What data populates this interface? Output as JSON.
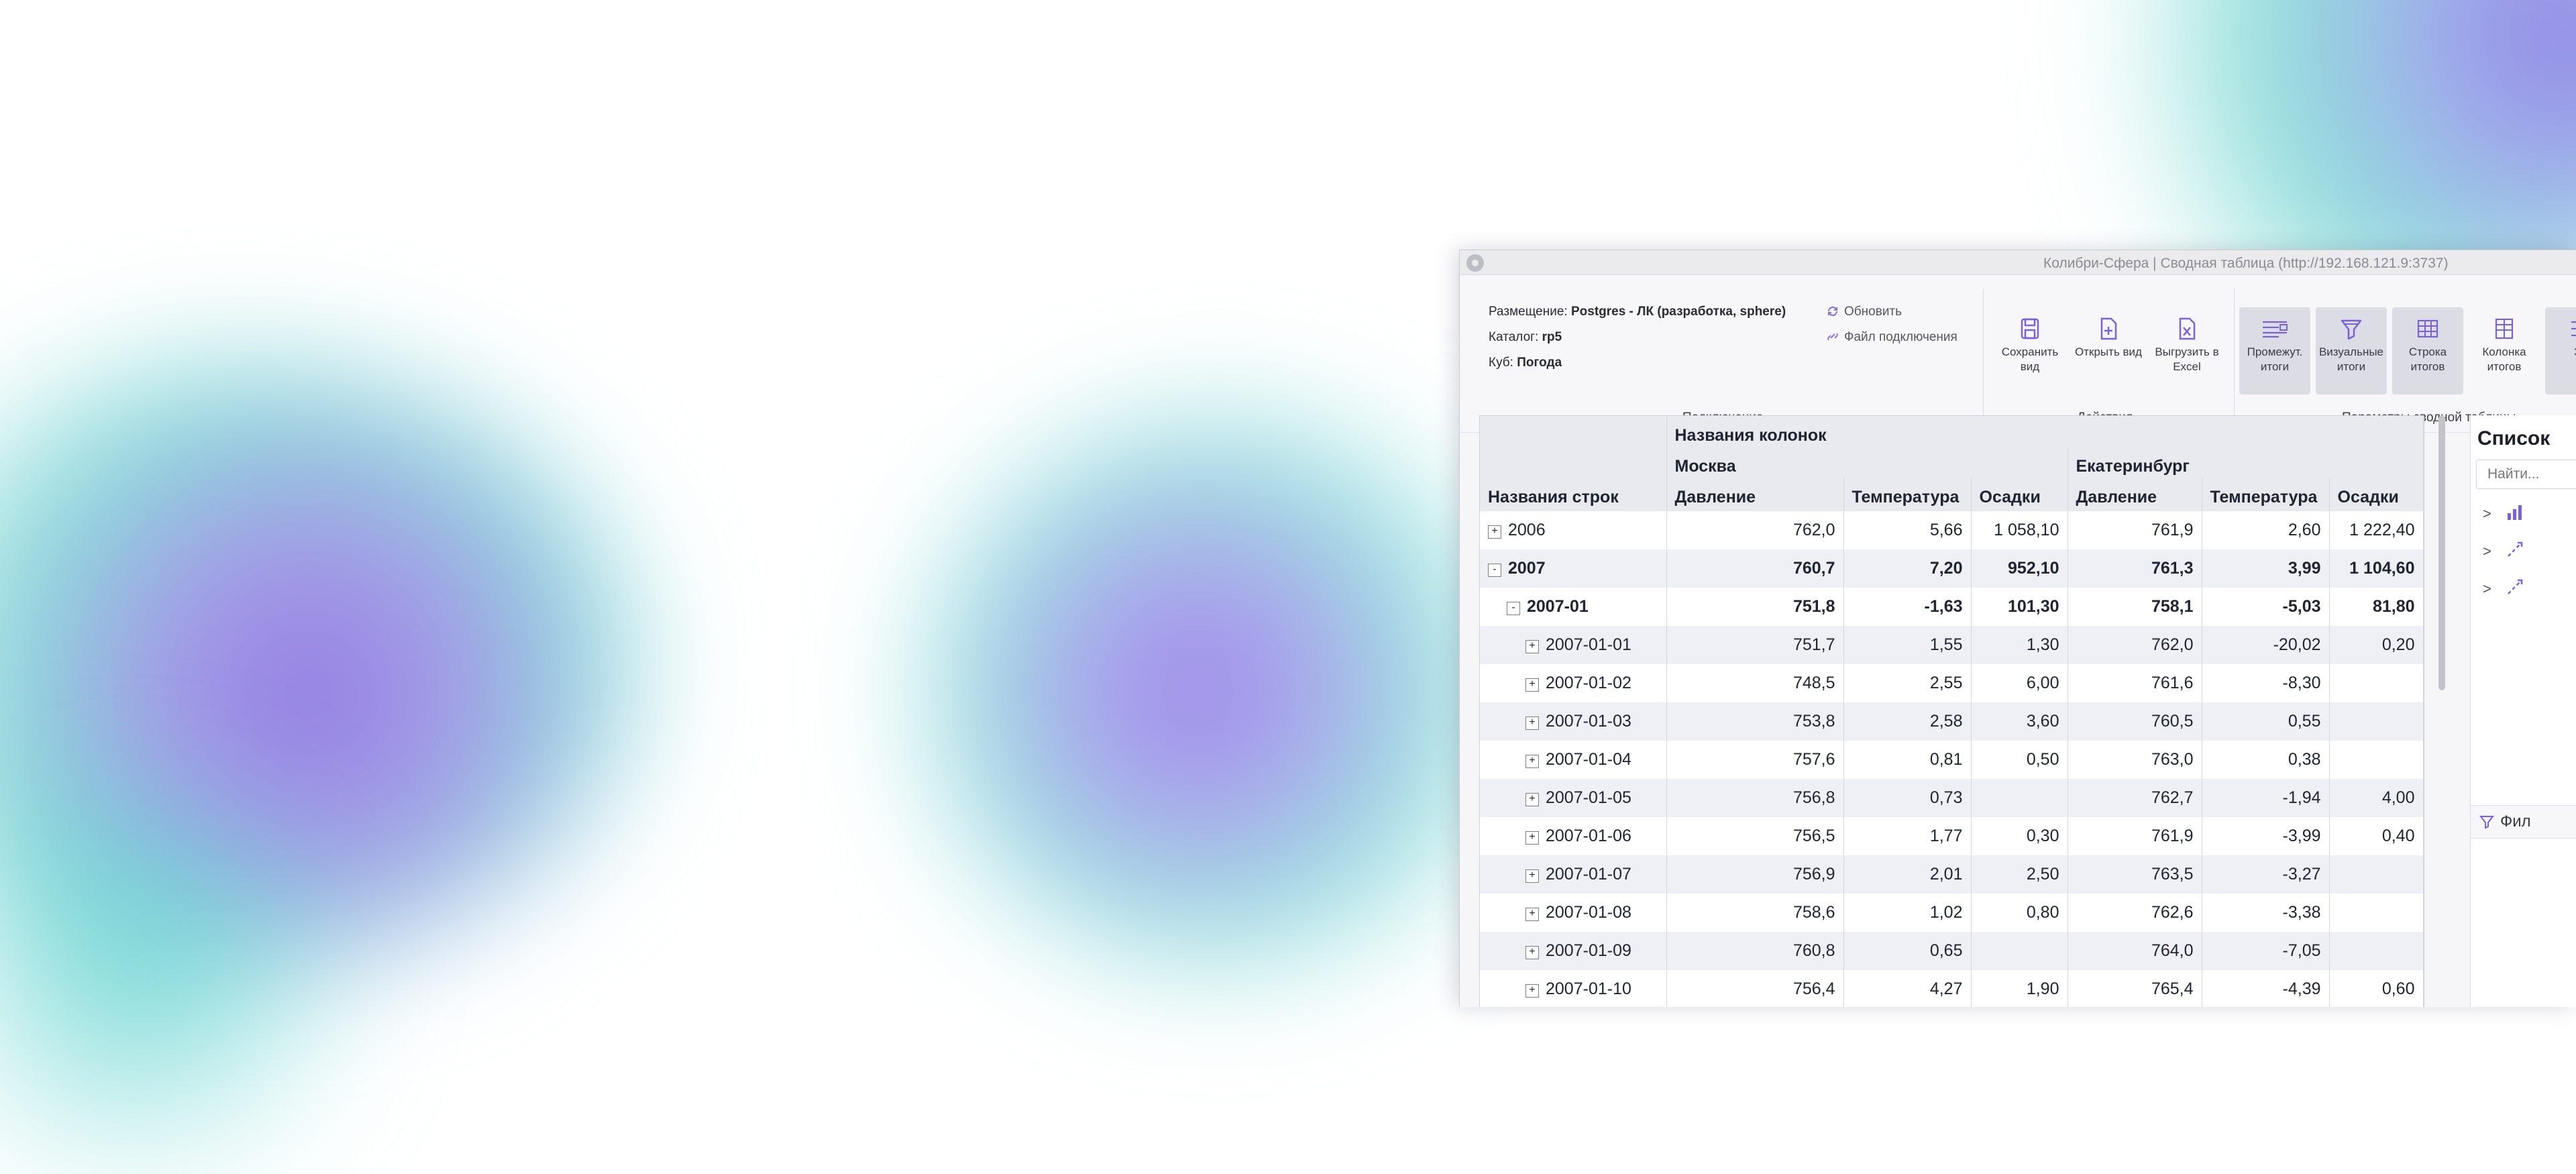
{
  "window": {
    "title": "Колибри-Сфера | Сводная таблица (http://192.168.121.9:3737)"
  },
  "connection": {
    "placement_label": "Размещение:",
    "placement_value": "Postgres - ЛК (разработка, sphere)",
    "catalog_label": "Каталог:",
    "catalog_value": "rp5",
    "cube_label": "Куб:",
    "cube_value": "Погода",
    "refresh_label": "Обновить",
    "conn_file_label": "Файл подключения",
    "group_label": "Подключение"
  },
  "actions": {
    "save_view": "Сохранить вид",
    "open_view": "Открыть вид",
    "export_excel": "Выгрузить в Excel",
    "group_label": "Действия"
  },
  "pivot_params": {
    "subtotals": "Промежут. итоги",
    "visual_totals": "Визуальные итоги",
    "row_totals": "Строка итогов",
    "col_totals": "Колонка итогов",
    "cut_label": "За",
    "group_label": "Параметры сводной таблицы"
  },
  "accent_color": "#7b61d8",
  "table": {
    "row_header": "Названия строк",
    "col_header": "Названия колонок",
    "cities": [
      "Москва",
      "Екатеринбург"
    ],
    "measures": [
      "Давление",
      "Температура",
      "Осадки"
    ],
    "rows": [
      {
        "label": "2006",
        "toggle": "+",
        "level": 0,
        "bold": false,
        "values": [
          "762,0",
          "5,66",
          "1 058,10",
          "761,9",
          "2,60",
          "1 222,40"
        ]
      },
      {
        "label": "2007",
        "toggle": "-",
        "level": 0,
        "bold": true,
        "values": [
          "760,7",
          "7,20",
          "952,10",
          "761,3",
          "3,99",
          "1 104,60"
        ]
      },
      {
        "label": "2007-01",
        "toggle": "-",
        "level": 1,
        "bold": true,
        "values": [
          "751,8",
          "-1,63",
          "101,30",
          "758,1",
          "-5,03",
          "81,80"
        ]
      },
      {
        "label": "2007-01-01",
        "toggle": "+",
        "level": 2,
        "bold": false,
        "values": [
          "751,7",
          "1,55",
          "1,30",
          "762,0",
          "-20,02",
          "0,20"
        ]
      },
      {
        "label": "2007-01-02",
        "toggle": "+",
        "level": 2,
        "bold": false,
        "values": [
          "748,5",
          "2,55",
          "6,00",
          "761,6",
          "-8,30",
          ""
        ]
      },
      {
        "label": "2007-01-03",
        "toggle": "+",
        "level": 2,
        "bold": false,
        "values": [
          "753,8",
          "2,58",
          "3,60",
          "760,5",
          "0,55",
          ""
        ]
      },
      {
        "label": "2007-01-04",
        "toggle": "+",
        "level": 2,
        "bold": false,
        "values": [
          "757,6",
          "0,81",
          "0,50",
          "763,0",
          "0,38",
          ""
        ]
      },
      {
        "label": "2007-01-05",
        "toggle": "+",
        "level": 2,
        "bold": false,
        "values": [
          "756,8",
          "0,73",
          "",
          "762,7",
          "-1,94",
          "4,00"
        ]
      },
      {
        "label": "2007-01-06",
        "toggle": "+",
        "level": 2,
        "bold": false,
        "values": [
          "756,5",
          "1,77",
          "0,30",
          "761,9",
          "-3,99",
          "0,40"
        ]
      },
      {
        "label": "2007-01-07",
        "toggle": "+",
        "level": 2,
        "bold": false,
        "values": [
          "756,9",
          "2,01",
          "2,50",
          "763,5",
          "-3,27",
          ""
        ]
      },
      {
        "label": "2007-01-08",
        "toggle": "+",
        "level": 2,
        "bold": false,
        "values": [
          "758,6",
          "1,02",
          "0,80",
          "762,6",
          "-3,38",
          ""
        ]
      },
      {
        "label": "2007-01-09",
        "toggle": "+",
        "level": 2,
        "bold": false,
        "values": [
          "760,8",
          "0,65",
          "",
          "764,0",
          "-7,05",
          ""
        ]
      },
      {
        "label": "2007-01-10",
        "toggle": "+",
        "level": 2,
        "bold": false,
        "values": [
          "756,4",
          "4,27",
          "1,90",
          "765,4",
          "-4,39",
          "0,60"
        ]
      }
    ]
  },
  "field_list": {
    "title": "Список",
    "search_placeholder": "Найти...",
    "filter_label": "Фил"
  }
}
